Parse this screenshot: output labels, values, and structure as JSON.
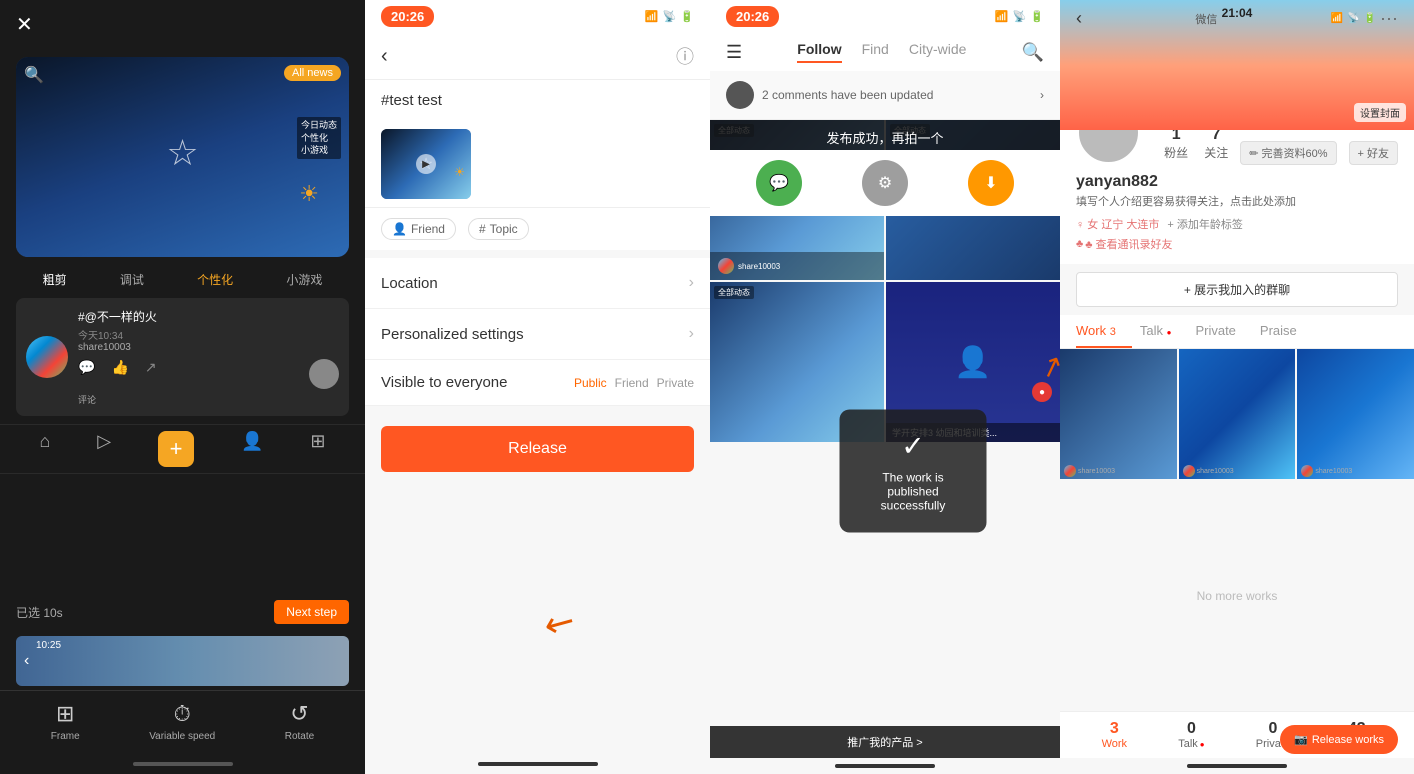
{
  "panel1": {
    "close_label": "✕",
    "all_news": "All news",
    "tabs": [
      "粗剪",
      "调试",
      "个性化",
      "小游戏"
    ],
    "card_title": "#@不一样的火",
    "card_time": "今天10:34",
    "card_user": "share10003",
    "selected_label": "已选 10s",
    "next_step_label": "Next step",
    "toolbar_items": [
      "Frame",
      "Variable speed",
      "Rotate"
    ],
    "toolbar_icons": [
      "⊞",
      "⏱",
      "↺"
    ]
  },
  "panel2": {
    "status_time": "20:26",
    "post_title": "#test test",
    "friend_label": "Friend",
    "topic_label": "Topic",
    "location_label": "Location",
    "personalized_label": "Personalized settings",
    "visible_label": "Visible to everyone",
    "visibility_options": [
      "Public",
      "Friend",
      "Private"
    ],
    "release_label": "Release",
    "info_icon": "ⓘ"
  },
  "panel3": {
    "status_time": "20:26",
    "tabs": [
      "Follow",
      "Find",
      "City-wide"
    ],
    "active_tab": "Follow",
    "comments_text": "2 comments have been updated",
    "publish_success": "发布成功，再拍一个",
    "success_toast_text": "The work is published successfully",
    "action_labels": [
      "微信",
      "设置",
      "下载"
    ],
    "promo_text": "推广我的产品 >"
  },
  "panel4": {
    "status_time": "21:04",
    "wechat_label": "微信",
    "cover_btn": "设置封面",
    "username": "yanyan882",
    "followers": "1",
    "following": "7",
    "followers_label": "粉丝",
    "following_label": "关注",
    "complete_profile": "完善资料60%",
    "add_friend": "+ 好友",
    "bio": "填写个人介绍更容易获得关注，点击此处添加",
    "tag1": "♀ 女  辽宁 大连市",
    "tag2": "+ 添加年龄标签",
    "tag3": "♣ 查看通讯录好友",
    "group_btn": "+ 展示我加入的群聊",
    "tabs": [
      "Work",
      "Talk",
      "Private",
      "Praise"
    ],
    "work_count": "3",
    "talk_count": "0",
    "private_count": "0",
    "praise_count": "43",
    "release_works": "Release works"
  },
  "arrow_indicator": "→"
}
